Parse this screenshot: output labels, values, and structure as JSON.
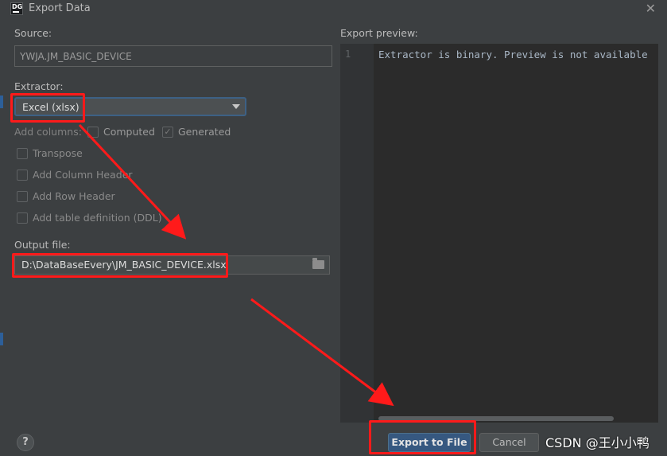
{
  "window": {
    "app_icon_text": "DG",
    "title": "Export Data",
    "close_icon": "close-icon"
  },
  "source": {
    "label": "Source:",
    "value": "YWJA.JM_BASIC_DEVICE"
  },
  "extractor": {
    "label": "Extractor:",
    "selected": "Excel (xlsx)"
  },
  "add_columns": {
    "label": "Add columns:",
    "computed": {
      "label": "Computed",
      "checked": false
    },
    "generated": {
      "label": "Generated",
      "checked": true
    }
  },
  "options": [
    {
      "label": "Transpose",
      "checked": false
    },
    {
      "label": "Add Column Header",
      "checked": false
    },
    {
      "label": "Add Row Header",
      "checked": false
    },
    {
      "label": "Add table definition (DDL)",
      "checked": false
    }
  ],
  "output_file": {
    "label": "Output file:",
    "value": "D:\\DataBaseEvery\\JM_BASIC_DEVICE.xlsx"
  },
  "preview": {
    "label": "Export preview:",
    "line_number": "1",
    "text": "Extractor is binary. Preview is not available"
  },
  "buttons": {
    "help": "?",
    "export": "Export to File",
    "cancel": "Cancel"
  },
  "watermark": "CSDN @王小小鸭",
  "colors": {
    "background": "#3c3f41",
    "annotation_red": "#ff1a1a",
    "primary_button": "#365880"
  }
}
